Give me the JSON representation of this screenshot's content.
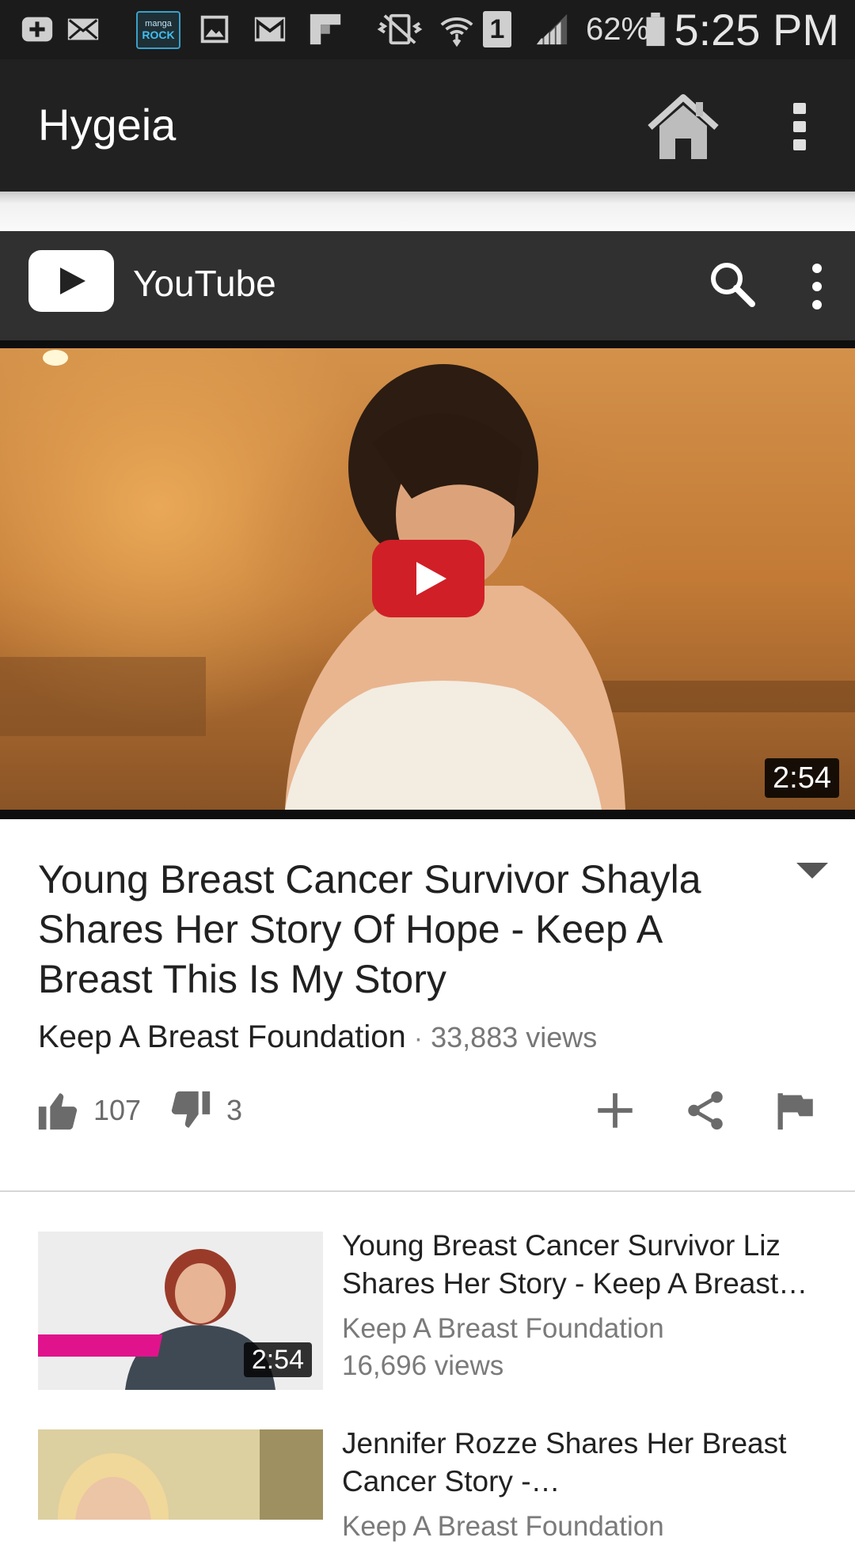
{
  "status_bar": {
    "icons": [
      "add-box-icon",
      "mail-icon",
      "manga-rock-icon",
      "image-icon",
      "gmail-icon",
      "flipboard-icon",
      "vibrate-icon",
      "wifi-icon",
      "sim-1-icon",
      "signal-icon",
      "battery-icon"
    ],
    "manga_label_top": "manga",
    "manga_label_bottom": "ROCK",
    "sim_label": "1",
    "battery": "62%",
    "time": "5:25 PM"
  },
  "app_bar": {
    "title": "Hygeia",
    "home_icon": "home-icon",
    "menu_icon": "overflow-menu-icon"
  },
  "youtube_header": {
    "title": "YouTube",
    "search_icon": "search-icon",
    "menu_icon": "overflow-menu-icon"
  },
  "video": {
    "duration": "2:54",
    "title": "Young Breast Cancer Survivor Shayla Shares Her Story Of Hope - Keep A Breast This Is My Story",
    "channel": "Keep A Breast Foundation",
    "separator": "·",
    "views": "33,883 views",
    "likes": "107",
    "dislikes": "3"
  },
  "actions": [
    "add-to-playlist-icon",
    "share-icon",
    "flag-icon"
  ],
  "related": [
    {
      "title": "Young Breast Cancer Survivor Liz Shares Her Story - Keep A Breast…",
      "channel": "Keep A Breast Foundation",
      "views": "16,696 views",
      "duration": "2:54"
    },
    {
      "title": "Jennifer Rozze Shares Her Breast Cancer Story -…",
      "channel": "Keep A Breast Foundation"
    }
  ],
  "colors": {
    "status_bar": "#1b1b1b",
    "app_bar": "#212121",
    "youtube_header": "#303030",
    "play_button": "#d01f27"
  }
}
